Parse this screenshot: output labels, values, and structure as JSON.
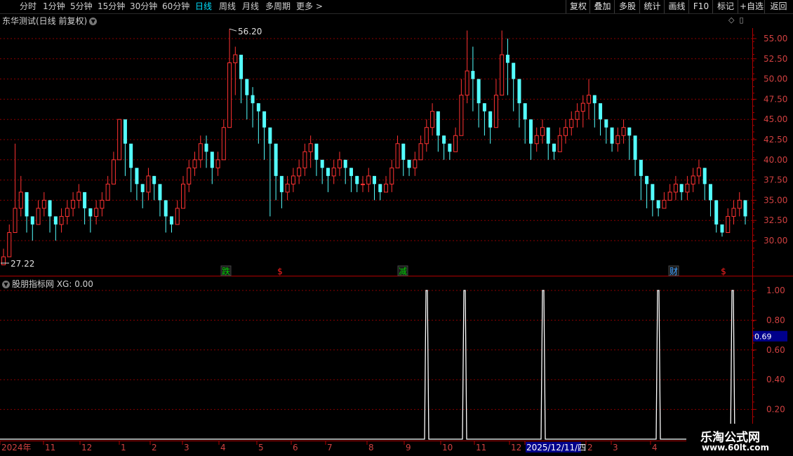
{
  "toolbar": {
    "periods": [
      {
        "label": "分时",
        "active": false
      },
      {
        "label": "1分钟",
        "active": false
      },
      {
        "label": "5分钟",
        "active": false
      },
      {
        "label": "15分钟",
        "active": false
      },
      {
        "label": "30分钟",
        "active": false
      },
      {
        "label": "60分钟",
        "active": false
      },
      {
        "label": "日线",
        "active": true
      },
      {
        "label": "周线",
        "active": false
      },
      {
        "label": "月线",
        "active": false
      },
      {
        "label": "多周期",
        "active": false
      },
      {
        "label": "更多 >",
        "active": false
      }
    ],
    "tools": [
      "复权",
      "叠加",
      "多股",
      "统计",
      "画线",
      "F10",
      "标记",
      "+自选",
      "返回"
    ]
  },
  "main_chart": {
    "title": "东华测试(日线 前复权)",
    "title_icon": "chevron-down-icon",
    "right_icons": [
      "diamond-icon",
      "pin-icon"
    ],
    "high_label": "56.20",
    "low_label": "27.22",
    "y_ticks": [
      "55.00",
      "52.50",
      "50.00",
      "47.50",
      "45.00",
      "42.50",
      "40.00",
      "37.50",
      "35.00",
      "32.50",
      "30.00"
    ],
    "markers": [
      {
        "text": "跌",
        "color": "#00d000",
        "box": true
      },
      {
        "text": "$",
        "color": "#ff2020",
        "box": false
      },
      {
        "text": "减",
        "color": "#00d000",
        "box": true
      },
      {
        "text": "财",
        "color": "#40a0ff",
        "box": true
      },
      {
        "text": "$",
        "color": "#ff2020",
        "box": false
      }
    ]
  },
  "indicator": {
    "title_icon": "chevron-down-icon",
    "title": "股朋指标网 XG: 0.00",
    "y_ticks": [
      "1.00",
      "0.80",
      "0.60",
      "0.40",
      "0.20"
    ],
    "cursor_value": "0.69"
  },
  "x_axis": {
    "labels": [
      "2024年",
      "11",
      "12",
      "1",
      "2",
      "3",
      "4",
      "5",
      "6",
      "7",
      "8",
      "9",
      "10",
      "11",
      "12",
      "2025/12/11/四",
      "2",
      "3",
      "4"
    ]
  },
  "watermark": {
    "title": "乐淘公式网",
    "url": "www.60lt.com"
  },
  "colors": {
    "up": "#ff3232",
    "down": "#54ffff",
    "grid": "#8b0000",
    "axis": "#b00000",
    "active_period": "#00e0ff",
    "signal": "#ffffff",
    "cursor_box": "#00008b"
  },
  "chart_data": [
    {
      "type": "candlestick",
      "title": "东华测试(日线 前复权)",
      "ylim": [
        27.22,
        56.2
      ],
      "y_ticks": [
        55,
        52.5,
        50,
        47.5,
        45,
        42.5,
        40,
        37.5,
        35,
        32.5,
        30
      ],
      "x_months": [
        "2024年",
        "11",
        "12",
        "1",
        "2",
        "3",
        "4",
        "5",
        "6",
        "7",
        "8",
        "9",
        "10",
        "11",
        "12",
        "2025/12/11/四",
        "2",
        "3",
        "4"
      ],
      "closes": [
        28,
        31,
        34,
        36,
        33,
        32,
        34,
        35,
        33,
        32,
        33,
        34,
        35,
        36,
        34,
        33,
        34,
        35,
        37,
        40,
        45,
        42,
        39,
        37,
        36,
        38,
        37,
        35,
        33,
        32,
        34,
        37,
        39,
        40,
        42,
        41,
        39,
        40,
        44,
        52,
        53,
        50,
        48,
        47,
        46,
        44,
        42,
        38,
        36,
        37,
        38,
        39,
        41,
        42,
        40,
        39,
        38,
        39,
        40,
        39,
        38,
        37,
        37,
        38,
        37,
        36,
        37,
        39,
        42,
        40,
        39,
        40,
        42,
        44,
        46,
        43,
        42,
        41,
        43,
        48,
        51,
        50,
        47,
        46,
        44,
        48,
        53,
        52,
        50,
        47,
        45,
        42,
        43,
        44,
        42,
        41,
        43,
        44,
        45,
        46,
        47,
        48,
        47,
        45,
        44,
        42,
        43,
        44,
        43,
        40,
        38,
        37,
        35,
        34,
        35,
        36,
        37,
        36,
        37,
        38,
        39,
        37,
        35,
        32,
        31,
        33,
        34,
        35,
        33
      ],
      "highs": [
        29,
        32,
        42,
        38,
        35,
        33,
        35,
        36,
        34,
        33,
        34,
        35,
        36,
        37,
        35,
        34,
        35,
        36,
        38,
        41,
        45,
        44,
        41,
        38,
        37,
        39,
        38,
        36,
        34,
        33,
        35,
        38,
        40,
        41,
        43,
        43,
        40,
        41,
        45,
        56.2,
        54,
        52,
        50,
        49,
        47,
        45,
        43,
        39,
        37,
        38,
        39,
        40,
        42,
        43,
        41,
        40,
        39,
        40,
        41,
        40,
        39,
        38,
        38,
        39,
        38,
        37,
        38,
        40,
        43,
        42,
        40,
        41,
        43,
        45,
        47,
        44,
        43,
        42,
        44,
        50,
        56,
        54,
        49,
        47,
        46,
        50,
        56,
        55,
        52,
        49,
        46,
        44,
        44,
        45,
        43,
        42,
        44,
        45,
        46,
        47,
        48,
        50,
        48,
        46,
        45,
        43,
        44,
        45,
        44,
        41,
        39,
        38,
        36,
        35,
        36,
        37,
        38,
        37,
        38,
        39,
        40,
        39,
        36,
        34,
        32,
        34,
        35,
        36,
        34
      ],
      "lows": [
        27.22,
        28,
        31,
        33,
        31,
        30,
        32,
        33,
        31,
        30,
        31,
        32,
        33,
        34,
        32,
        31,
        32,
        33,
        35,
        37,
        41,
        38,
        36,
        35,
        34,
        35,
        35,
        33,
        31,
        31,
        32,
        34,
        36,
        38,
        39,
        39,
        37,
        38,
        41,
        45,
        48,
        47,
        45,
        44,
        42,
        40,
        33,
        35,
        34,
        35,
        36,
        37,
        38,
        39,
        38,
        37,
        36,
        37,
        38,
        37,
        36,
        36,
        36,
        36,
        35,
        35,
        36,
        36,
        39,
        38,
        38,
        38,
        40,
        41,
        43,
        41,
        40,
        40,
        41,
        44,
        47,
        46,
        44,
        43,
        42,
        44,
        48,
        48,
        46,
        44,
        42,
        40,
        41,
        42,
        40,
        40,
        41,
        42,
        43,
        44,
        44,
        45,
        44,
        43,
        42,
        41,
        41,
        42,
        40,
        38,
        35,
        34,
        33,
        33,
        34,
        35,
        35,
        35,
        35,
        36,
        37,
        35,
        33,
        31,
        30.5,
        31,
        32,
        33,
        32
      ]
    },
    {
      "type": "line",
      "series": [
        {
          "name": "XG",
          "values": [
            0,
            0,
            0,
            0,
            0,
            0,
            0,
            0,
            0,
            0,
            0,
            0,
            0,
            0,
            0,
            0,
            0,
            0,
            0,
            0,
            0,
            0,
            0,
            0,
            0,
            0,
            0,
            0,
            0,
            0,
            0,
            0,
            0,
            0,
            0,
            0,
            0,
            0,
            0,
            0,
            0,
            0,
            0,
            0,
            0,
            0,
            0,
            0,
            0,
            0,
            0,
            0,
            0,
            0,
            0,
            0,
            0,
            0,
            0,
            0,
            0,
            0,
            0,
            0,
            0,
            0,
            0,
            0,
            0,
            0,
            0,
            0,
            0,
            0,
            0,
            0,
            0,
            0,
            0,
            0,
            0,
            0,
            0,
            0,
            0,
            0,
            0,
            0,
            0,
            0,
            0,
            0,
            0,
            0,
            0,
            0,
            0,
            0,
            0,
            0,
            0,
            0,
            0,
            0,
            0,
            0,
            0,
            0,
            0,
            0,
            0,
            0,
            0,
            0,
            0,
            0,
            0,
            0,
            0,
            0,
            0,
            0,
            0,
            0,
            0,
            0,
            0,
            0,
            0
          ]
        }
      ],
      "signal_x": [
        608,
        662,
        774,
        938,
        1044
      ],
      "signal_value": 1.0,
      "ylim": [
        0,
        1.05
      ],
      "y_ticks": [
        1.0,
        0.8,
        0.6,
        0.4,
        0.2
      ]
    }
  ]
}
